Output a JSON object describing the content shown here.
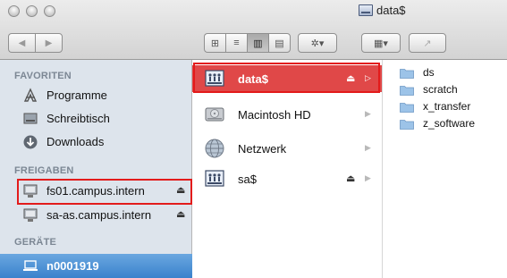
{
  "window": {
    "title": "data$",
    "title_icon": "network-share-icon"
  },
  "toolbar": {
    "nav_back_glyph": "◀",
    "nav_forward_glyph": "▶",
    "view_icons_glyph": "⊞",
    "view_list_glyph": "≡",
    "view_columns_glyph": "▥",
    "view_coverflow_glyph": "▤",
    "action_glyph": "✲▾",
    "arrange_glyph": "▦▾",
    "share_glyph": "↗"
  },
  "sidebar": {
    "sections": [
      {
        "heading": "FAVORITEN"
      },
      {
        "heading": "FREIGABEN"
      },
      {
        "heading": "GERÄTE"
      }
    ],
    "favorites": [
      {
        "label": "Programme",
        "icon": "applications-icon"
      },
      {
        "label": "Schreibtisch",
        "icon": "desktop-icon"
      },
      {
        "label": "Downloads",
        "icon": "downloads-icon"
      }
    ],
    "shares": [
      {
        "label": "fs01.campus.intern",
        "icon": "server-icon",
        "eject": "⏏"
      },
      {
        "label": "sa-as.campus.intern",
        "icon": "server-icon",
        "eject": "⏏"
      }
    ],
    "devices": [
      {
        "label": "n0001919",
        "icon": "laptop-icon"
      }
    ]
  },
  "column1": {
    "items": [
      {
        "label": "data$",
        "icon": "network-volume-icon",
        "eject": "⏏",
        "chevron": "▷",
        "selected": true
      },
      {
        "label": "Macintosh HD",
        "icon": "hard-drive-icon",
        "eject": "",
        "chevron": "▶",
        "selected": false
      },
      {
        "label": "Netzwerk",
        "icon": "network-globe-icon",
        "eject": "",
        "chevron": "▶",
        "selected": false
      },
      {
        "label": "sa$",
        "icon": "network-volume-icon",
        "eject": "⏏",
        "chevron": "▶",
        "selected": false
      }
    ]
  },
  "column2": {
    "items": [
      {
        "label": "ds",
        "icon": "folder-icon"
      },
      {
        "label": "scratch",
        "icon": "folder-icon"
      },
      {
        "label": "x_transfer",
        "icon": "folder-icon"
      },
      {
        "label": "z_software",
        "icon": "folder-icon"
      }
    ]
  },
  "colors": {
    "sidebar_bg": "#dde4ec",
    "selected_red": "#e04848",
    "sidebar_selected_blue": "#3a82cc",
    "highlight_box": "#e31b1b",
    "folder_blue": "#9cc3e8"
  }
}
